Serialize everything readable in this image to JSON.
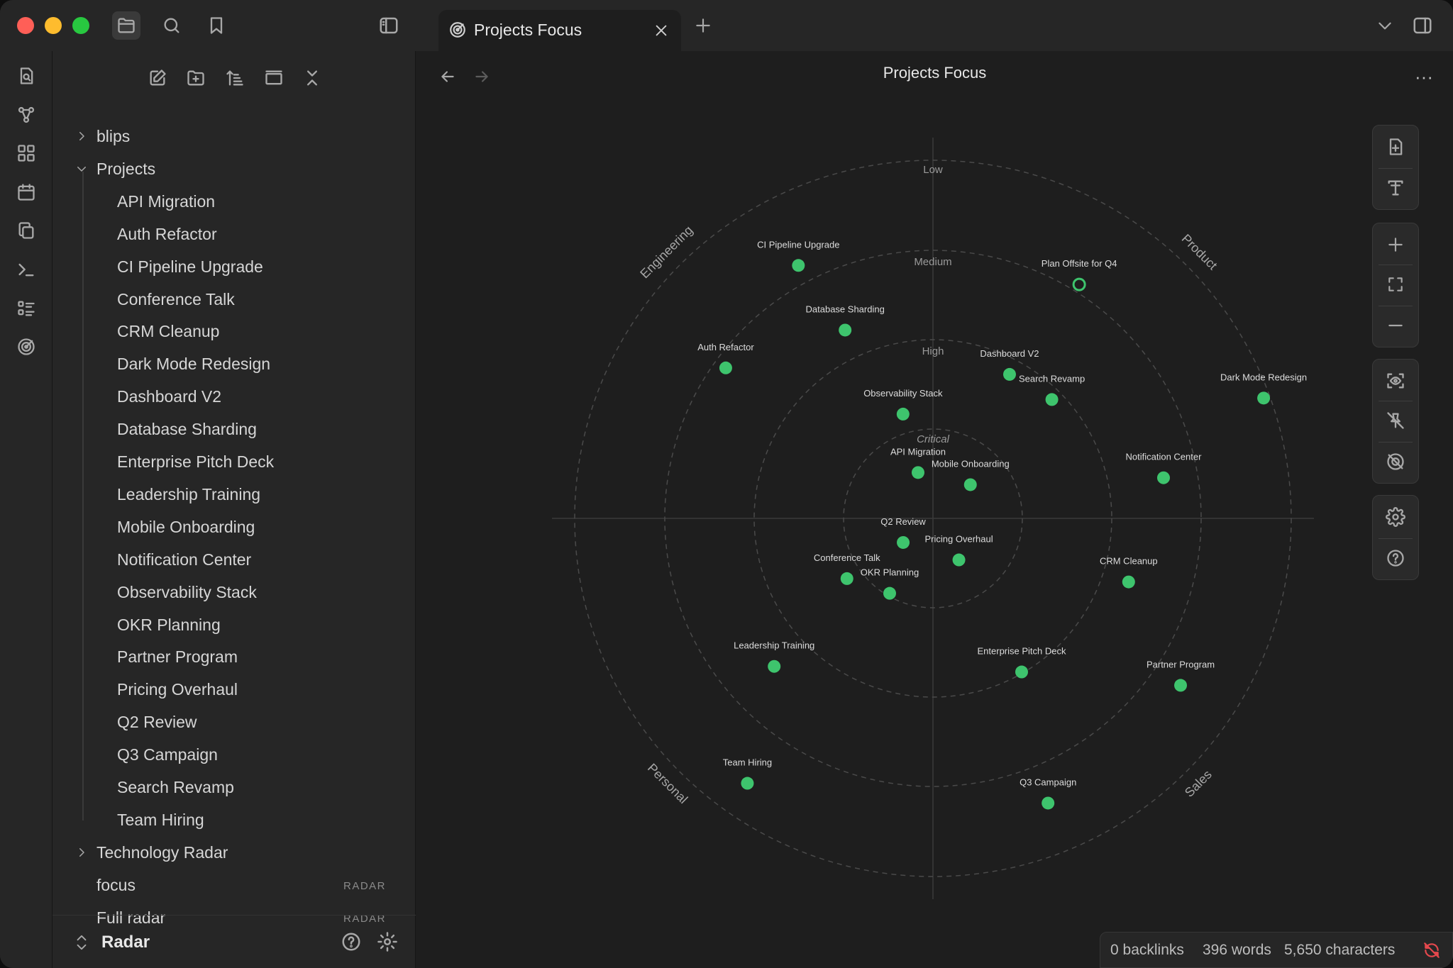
{
  "window": {
    "traffic_lights": [
      "close",
      "minimize",
      "zoom"
    ]
  },
  "tabs": [
    {
      "label": "Projects Focus",
      "icon": "radar-icon"
    }
  ],
  "ribbon": {
    "icons": [
      "search-note-icon",
      "graph-icon",
      "canvas-icon",
      "calendar-icon",
      "copy-icon",
      "terminal-icon",
      "list-icon",
      "radar-icon"
    ]
  },
  "sidebar": {
    "toolbar": [
      "new-note-icon",
      "new-folder-icon",
      "sort-icon",
      "collapse-view-icon",
      "close-all-icon"
    ],
    "tree": [
      {
        "label": "blips",
        "type": "folder",
        "expanded": false
      },
      {
        "label": "Projects",
        "type": "folder",
        "expanded": true
      },
      {
        "label": "API Migration",
        "type": "note"
      },
      {
        "label": "Auth Refactor",
        "type": "note"
      },
      {
        "label": "CI Pipeline Upgrade",
        "type": "note"
      },
      {
        "label": "Conference Talk",
        "type": "note"
      },
      {
        "label": "CRM Cleanup",
        "type": "note"
      },
      {
        "label": "Dark Mode Redesign",
        "type": "note"
      },
      {
        "label": "Dashboard V2",
        "type": "note"
      },
      {
        "label": "Database Sharding",
        "type": "note"
      },
      {
        "label": "Enterprise Pitch Deck",
        "type": "note"
      },
      {
        "label": "Leadership Training",
        "type": "note"
      },
      {
        "label": "Mobile Onboarding",
        "type": "note"
      },
      {
        "label": "Notification Center",
        "type": "note"
      },
      {
        "label": "Observability Stack",
        "type": "note"
      },
      {
        "label": "OKR Planning",
        "type": "note"
      },
      {
        "label": "Partner Program",
        "type": "note"
      },
      {
        "label": "Pricing Overhaul",
        "type": "note"
      },
      {
        "label": "Q2 Review",
        "type": "note"
      },
      {
        "label": "Q3 Campaign",
        "type": "note"
      },
      {
        "label": "Search Revamp",
        "type": "note"
      },
      {
        "label": "Team Hiring",
        "type": "note"
      },
      {
        "label": "Technology Radar",
        "type": "folder",
        "expanded": false
      },
      {
        "label": "focus",
        "type": "file",
        "badge": "RADAR"
      },
      {
        "label": "Full radar",
        "type": "file",
        "badge": "RADAR"
      }
    ],
    "footer": {
      "vault_name": "Radar"
    }
  },
  "main": {
    "title": "Projects Focus",
    "more_label": "···",
    "radar": {
      "rings": [
        "Low",
        "Medium",
        "High",
        "Critical"
      ],
      "quadrants": [
        "Engineering",
        "Product",
        "Personal",
        "Sales"
      ],
      "accent": "#3ec46d",
      "blips": [
        {
          "name": "CI Pipeline Upgrade",
          "quadrant": "Engineering",
          "ring": "Low"
        },
        {
          "name": "Auth Refactor",
          "quadrant": "Engineering",
          "ring": "Medium"
        },
        {
          "name": "Database Sharding",
          "quadrant": "Engineering",
          "ring": "High"
        },
        {
          "name": "Observability Stack",
          "quadrant": "Engineering",
          "ring": "High"
        },
        {
          "name": "API Migration",
          "quadrant": "Engineering",
          "ring": "Critical"
        },
        {
          "name": "Plan Offsite for Q4",
          "quadrant": "Product",
          "ring": "Medium",
          "hollow": true
        },
        {
          "name": "Dark Mode Redesign",
          "quadrant": "Product",
          "ring": "Low"
        },
        {
          "name": "Dashboard V2",
          "quadrant": "Product",
          "ring": "High"
        },
        {
          "name": "Search Revamp",
          "quadrant": "Product",
          "ring": "Critical"
        },
        {
          "name": "Mobile Onboarding",
          "quadrant": "Product",
          "ring": "Critical"
        },
        {
          "name": "Notification Center",
          "quadrant": "Product",
          "ring": "High"
        },
        {
          "name": "Q2 Review",
          "quadrant": "Personal",
          "ring": "Critical"
        },
        {
          "name": "Pricing Overhaul",
          "quadrant": "Sales",
          "ring": "Critical"
        },
        {
          "name": "Conference Talk",
          "quadrant": "Personal",
          "ring": "High"
        },
        {
          "name": "OKR Planning",
          "quadrant": "Personal",
          "ring": "Critical"
        },
        {
          "name": "CRM Cleanup",
          "quadrant": "Sales",
          "ring": "High"
        },
        {
          "name": "Leadership Training",
          "quadrant": "Personal",
          "ring": "Medium"
        },
        {
          "name": "Enterprise Pitch Deck",
          "quadrant": "Sales",
          "ring": "High"
        },
        {
          "name": "Partner Program",
          "quadrant": "Sales",
          "ring": "Low"
        },
        {
          "name": "Team Hiring",
          "quadrant": "Personal",
          "ring": "Low"
        },
        {
          "name": "Q3 Campaign",
          "quadrant": "Sales",
          "ring": "Low"
        }
      ]
    },
    "controls": [
      "new-note-icon",
      "text-icon",
      "zoom-in-icon",
      "fit-icon",
      "zoom-out-icon",
      "focus-icon",
      "unpin-icon",
      "hide-icon",
      "settings-icon",
      "help-icon"
    ]
  },
  "status": {
    "backlinks": "0 backlinks",
    "words": "396 words",
    "characters": "5,650 characters"
  }
}
